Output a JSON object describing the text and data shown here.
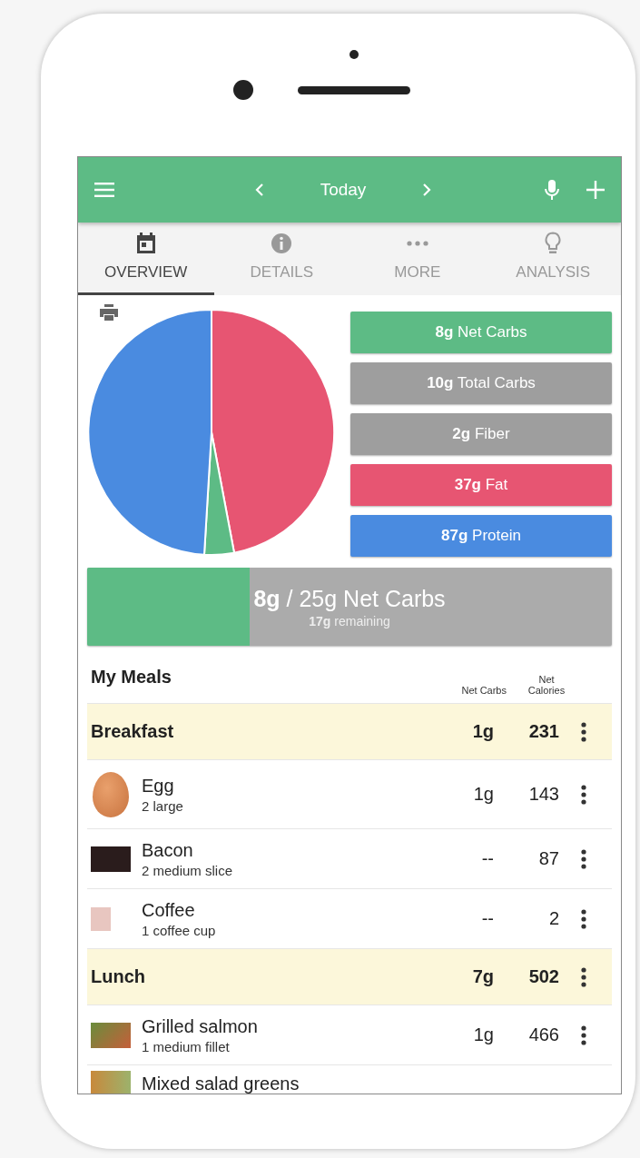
{
  "app_bar": {
    "title": "Today"
  },
  "tabs": [
    {
      "label": "OVERVIEW",
      "selected": true
    },
    {
      "label": "DETAILS",
      "selected": false
    },
    {
      "label": "MORE",
      "selected": false
    },
    {
      "label": "ANALYSIS",
      "selected": false
    }
  ],
  "macros": [
    {
      "text": "**8g** Net Carbs",
      "color": "#5dbb85"
    },
    {
      "text": "**10g** Total Carbs",
      "color": "#9e9e9e"
    },
    {
      "text": "**2g** Fiber",
      "color": "#9e9e9e"
    },
    {
      "text": "**37g** Fat",
      "color": "#e75572"
    },
    {
      "text": "**87g** Protein",
      "color": "#4a8be0"
    }
  ],
  "net_carbs_goal": {
    "text": "**8g** / 25g Net Carbs",
    "subtext": "**17g** remaining",
    "level": 0.31
  },
  "meals": {
    "title": "My Meals",
    "columns": [
      "Net Carbs",
      "Net Calories"
    ],
    "rows": [
      {
        "kind": "meal",
        "name": "Breakfast",
        "net_carbs": "1g",
        "calories": "231"
      },
      {
        "kind": "food",
        "name": "Egg",
        "serving": "2 large",
        "net_carbs": "1g",
        "calories": "143"
      },
      {
        "kind": "food",
        "name": "Bacon",
        "serving": "2 medium slice",
        "net_carbs": "--",
        "calories": "87"
      },
      {
        "kind": "food",
        "name": "Coffee",
        "serving": "1 coffee cup",
        "net_carbs": "--",
        "calories": "2"
      },
      {
        "kind": "meal",
        "name": "Lunch",
        "net_carbs": "7g",
        "calories": "502"
      },
      {
        "kind": "food",
        "name": "Grilled salmon",
        "serving": "1 medium fillet",
        "net_carbs": "1g",
        "calories": "466"
      },
      {
        "kind": "food",
        "name": "Mixed salad greens"
      }
    ]
  }
}
